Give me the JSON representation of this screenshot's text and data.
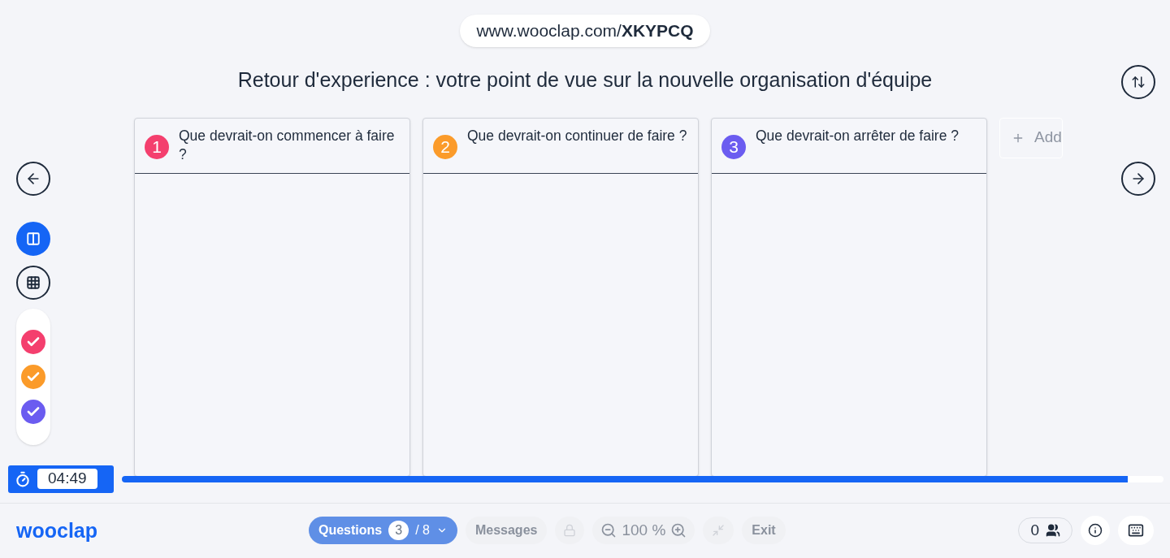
{
  "url": {
    "prefix": "www.wooclap.com/",
    "code": "XKYPCQ"
  },
  "title": "Retour d'experience : votre point de vue sur la nouvelle organisation d'équipe",
  "view_modes": [
    {
      "kind": "columns",
      "selected": true
    },
    {
      "kind": "grid",
      "selected": false
    }
  ],
  "filters": [
    {
      "color": "#f43f6e",
      "checked": true
    },
    {
      "color": "#fb9b2a",
      "checked": true
    },
    {
      "color": "#6b5cf0",
      "checked": true
    }
  ],
  "columns": [
    {
      "number": "1",
      "color": "#f43f6e",
      "label": "Que devrait-on commencer à faire ?"
    },
    {
      "number": "2",
      "color": "#fb9b2a",
      "label": "Que devrait-on continuer de faire ?"
    },
    {
      "number": "3",
      "color": "#6b5cf0",
      "label": "Que devrait-on arrêter de faire ?"
    }
  ],
  "add_column": {
    "label": "Add"
  },
  "timer": {
    "value": "04:49",
    "level": 0.966
  },
  "bottom_bar": {
    "logo": "wooclap",
    "questions": {
      "label": "Questions",
      "current": "3",
      "total": "/ 8"
    },
    "messages": "Messages",
    "zoom": "100 %",
    "exit": "Exit",
    "participants": "0"
  }
}
